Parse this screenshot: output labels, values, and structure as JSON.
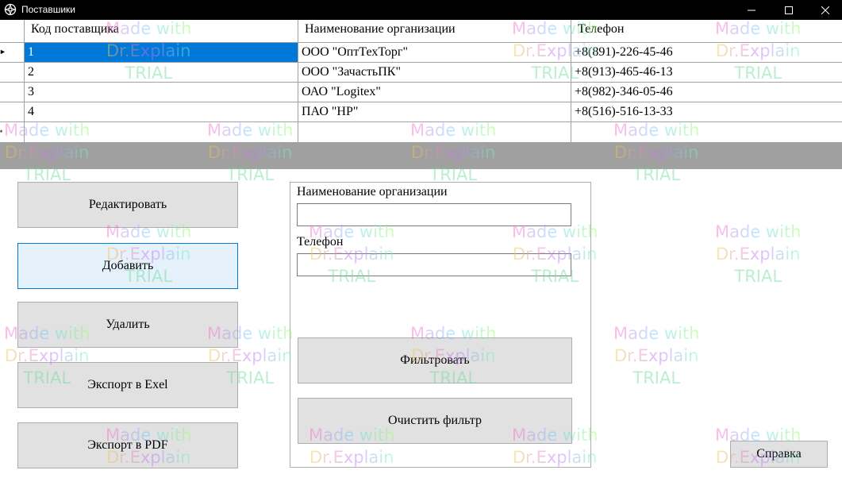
{
  "window": {
    "title": "Поставшики"
  },
  "grid": {
    "columns": [
      "Код поставщика",
      "Наименование организации",
      "Телефон"
    ],
    "rows": [
      {
        "id": "1",
        "name": "ООО \"ОптТехТорг\"",
        "phone": "+8(891)-226-45-46",
        "selected": true
      },
      {
        "id": "2",
        "name": "ООО \"ЗачастьПК\"",
        "phone": "+8(913)-465-46-13"
      },
      {
        "id": "3",
        "name": "ОАО \"Logitex\"",
        "phone": "+8(982)-346-05-46"
      },
      {
        "id": "4",
        "name": "ПАО \"HP\"",
        "phone": "+8(516)-516-13-33"
      }
    ]
  },
  "actions": {
    "edit": "Редактировать",
    "add": "Добавить",
    "delete": "Удалить",
    "export_excel": "Экспорт в Exel",
    "export_pdf": "Экспорт в PDF"
  },
  "filter": {
    "name_label": "Наименование организации",
    "name_value": "",
    "phone_label": "Телефон",
    "phone_value": "",
    "apply_label": "Фильтровать",
    "clear_label": "Очистить фильтр"
  },
  "help": {
    "label": "Справка"
  },
  "watermark": {
    "line1": "Made with",
    "line2": "Dr.Explain",
    "line3": "TRIAL"
  }
}
